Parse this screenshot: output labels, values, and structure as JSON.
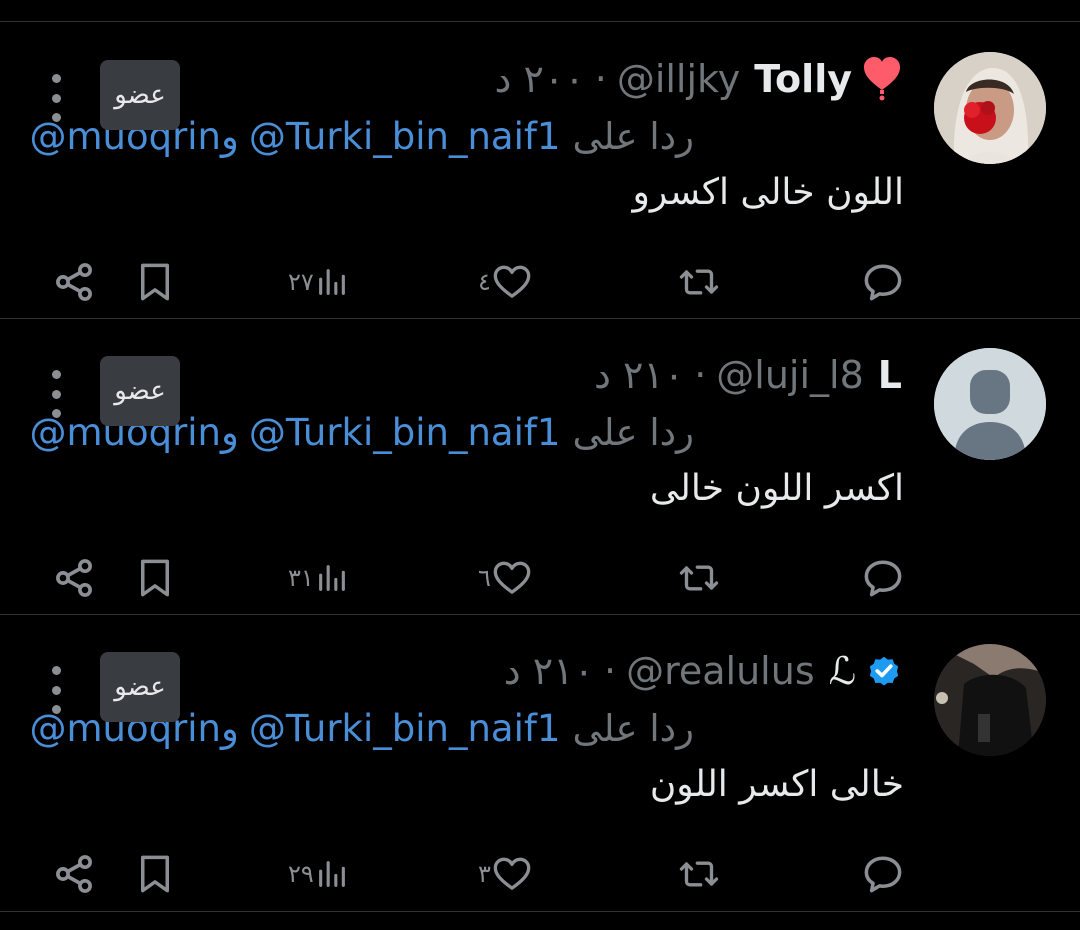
{
  "reply_prefix": "ردا على",
  "reply_mention_1": "@Turki_bin_naif1",
  "reply_conj": "و",
  "reply_mention_2": "@muoqrin",
  "member_label": "عضو",
  "tweets": [
    {
      "display_name": "Tolly",
      "handle": "@illjky",
      "dot": "·",
      "time_ago": "٢٠٠ د",
      "badge_icon": "red-heart-emoji",
      "text": "اللون خالى اكسرو",
      "likes": "٤",
      "views": "٢٧"
    },
    {
      "display_name": "L",
      "handle": "@luji_l8",
      "dot": "·",
      "time_ago": "٢١٠ د",
      "text": "اكسر اللون خالى",
      "likes": "٦",
      "views": "٣١"
    },
    {
      "display_name": "ℒ",
      "handle": "@realulus",
      "dot": "·",
      "time_ago": "٢١٠ د",
      "badge_icon": "verified-check-icon",
      "text": "خالى اكسر اللون",
      "likes": "٣",
      "views": "٢٩"
    }
  ],
  "colors": {
    "background": "#000000",
    "text": "#e7e9ea",
    "muted": "#71767b",
    "link": "#4a8ed8",
    "verified": "#1d9bf0",
    "member_badge_bg": "#393d42",
    "divider": "#2f3336"
  }
}
